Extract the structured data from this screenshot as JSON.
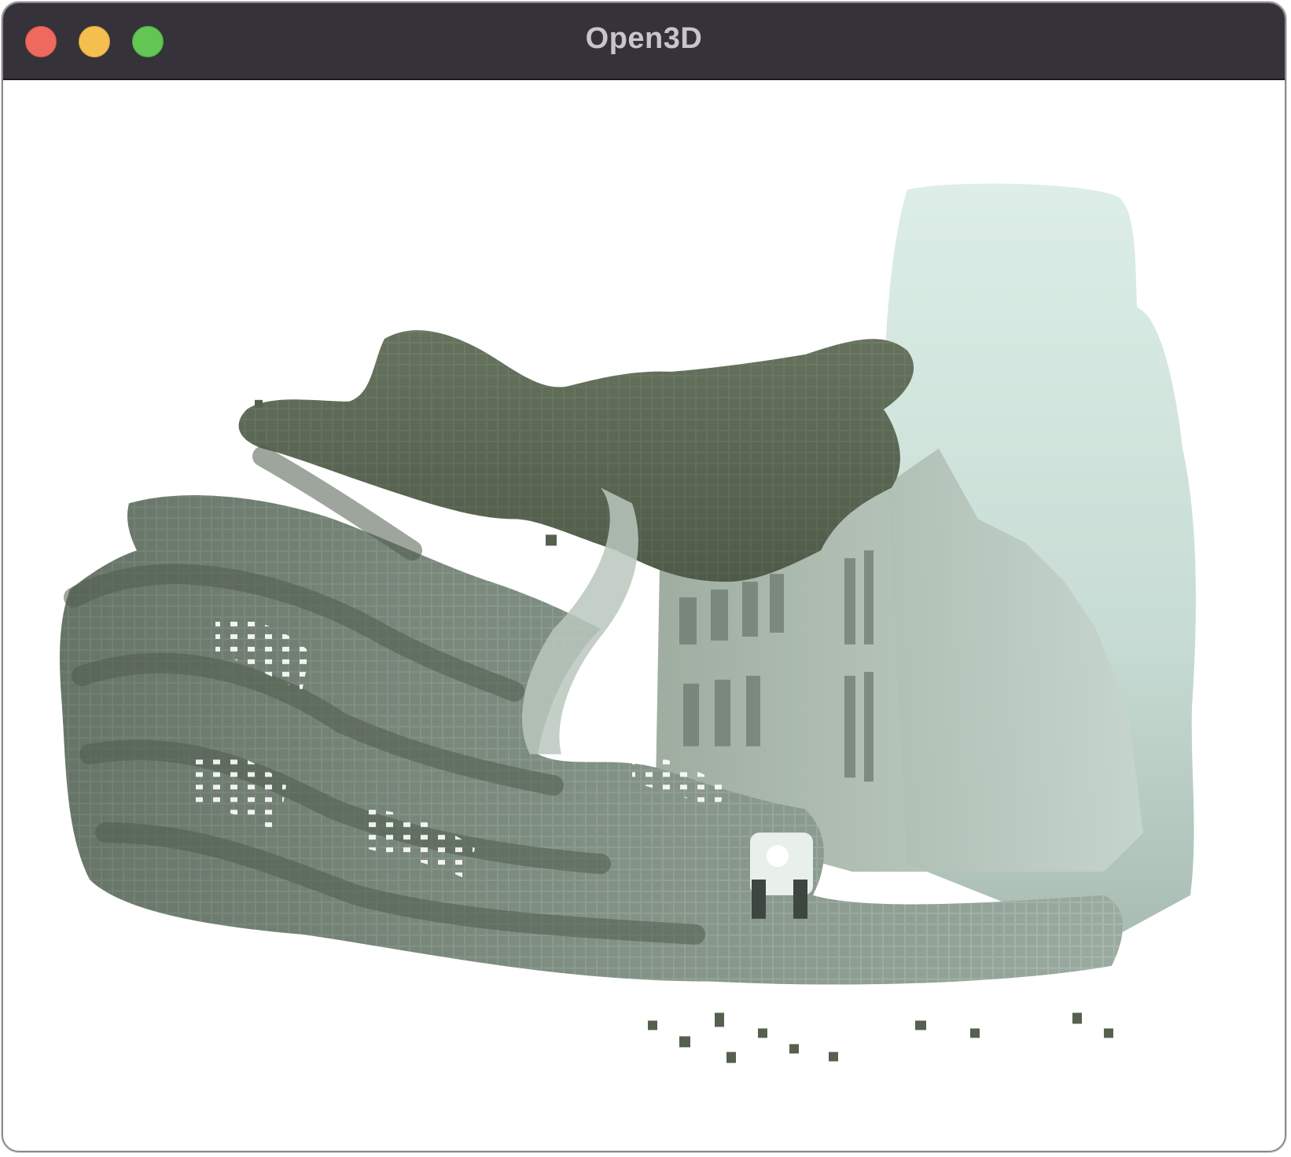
{
  "window": {
    "title": "Open3D"
  },
  "icons": {
    "close": "close-traffic-light-icon",
    "minimize": "minimize-traffic-light-icon",
    "maximize": "maximize-traffic-light-icon"
  },
  "colors": {
    "titlebar": "#36323a",
    "title_text": "#c9c5cc",
    "close": "#ee6a5f",
    "minimize": "#f5bf4f",
    "maximize": "#62c554",
    "background": "#ffffff",
    "point_cloud_dark": "#55604f",
    "point_cloud_mid": "#8a9a88",
    "point_cloud_light": "#d6ebe3"
  }
}
